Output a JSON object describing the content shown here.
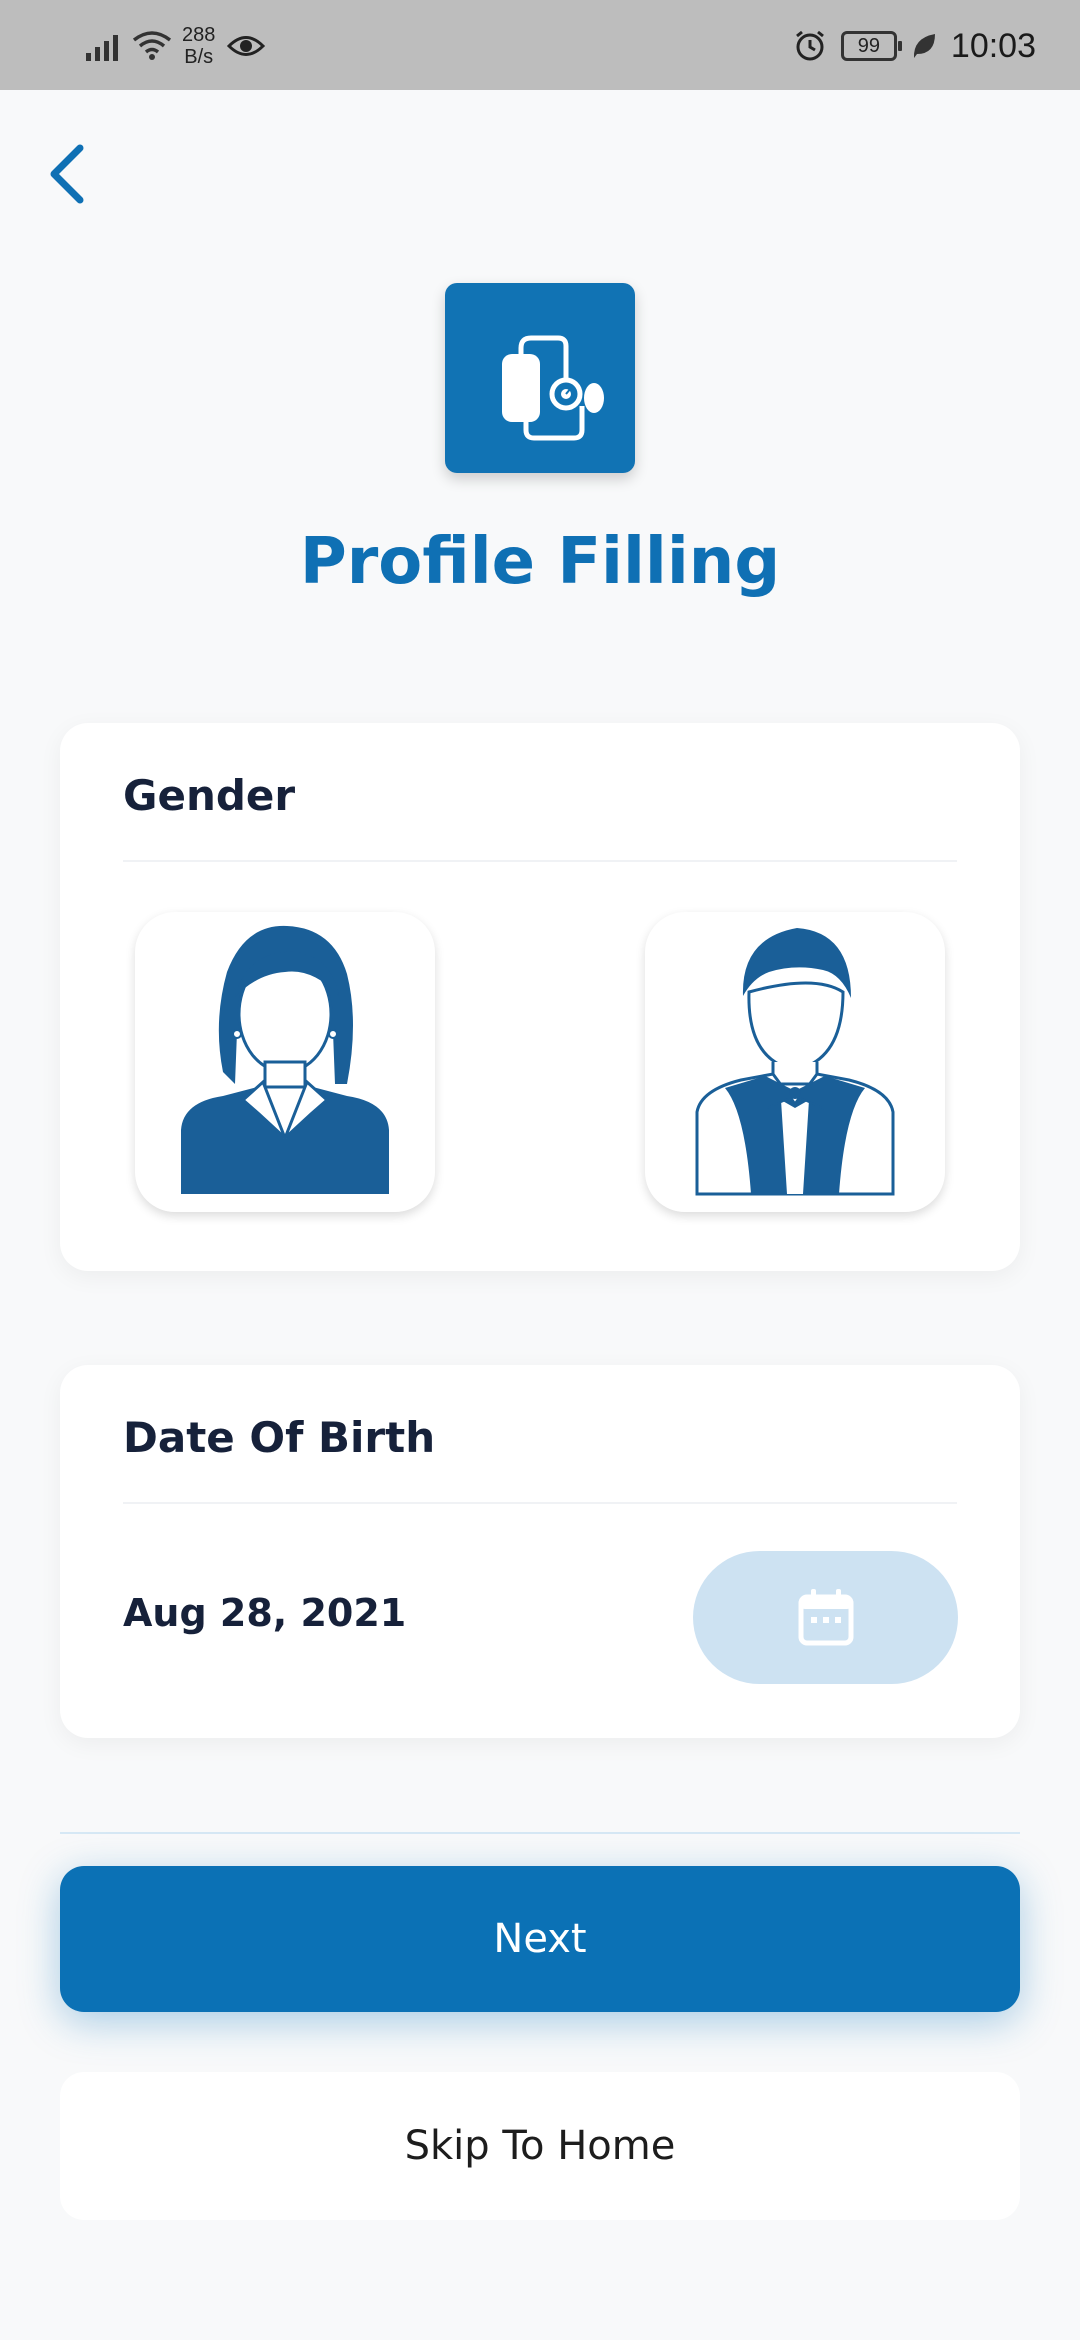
{
  "status_bar": {
    "network_speed_value": "288",
    "network_speed_unit": "B/s",
    "battery": "99",
    "time": "10:03"
  },
  "header": {
    "title": "Profile Filling",
    "logo_icon": "blood-pressure-monitor-icon"
  },
  "gender_card": {
    "title": "Gender",
    "options": [
      {
        "id": "female",
        "icon": "female-avatar-icon"
      },
      {
        "id": "male",
        "icon": "male-avatar-icon"
      }
    ]
  },
  "dob_card": {
    "title": "Date Of Birth",
    "value": "Aug 28, 2021",
    "picker_icon": "calendar-icon"
  },
  "actions": {
    "next_label": "Next",
    "skip_label": "Skip To Home"
  },
  "colors": {
    "primary": "#0b71b5",
    "title": "#0f70b4",
    "calendar_bg": "#cde2f2",
    "avatar": "#1a5f98"
  }
}
